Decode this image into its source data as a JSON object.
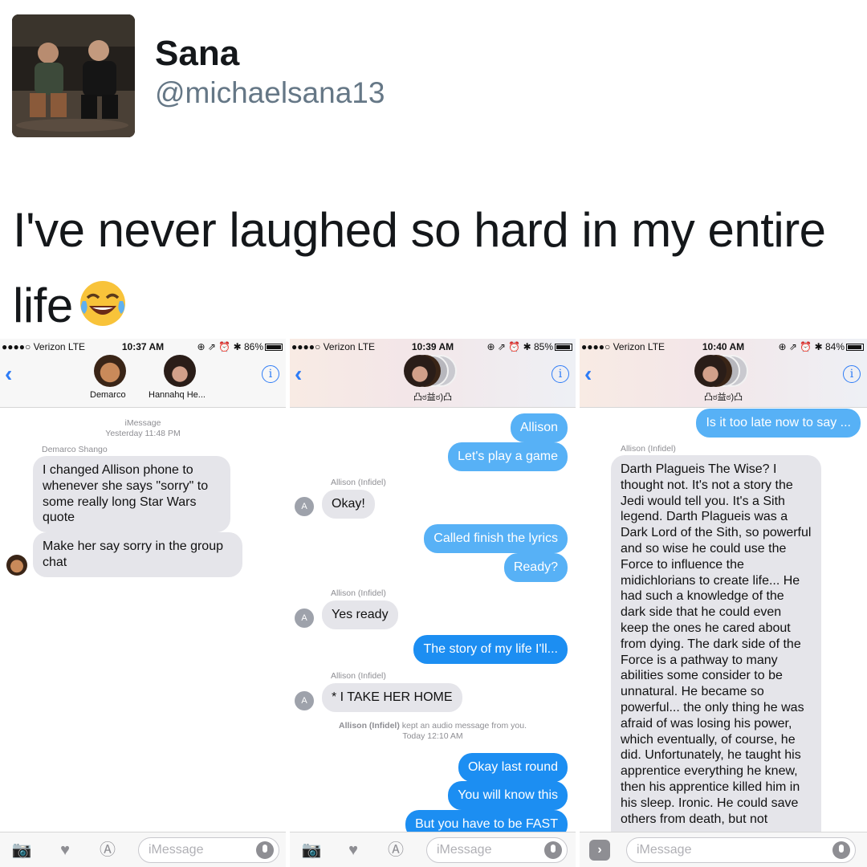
{
  "tweet": {
    "name": "Sana",
    "handle": "@michaelsana13",
    "text": "I've never laughed so hard in my entire life",
    "emoji_icon": "face-with-tears-of-joy-icon"
  },
  "screenshots": [
    {
      "status": {
        "carrier": "●●●●○ Verizon  LTE",
        "time": "10:37 AM",
        "icons": "⊕ ⇗ ⏰ ✱ 86%",
        "battery_level": 0.86
      },
      "contacts": [
        "Demarco",
        "Hannahq He..."
      ],
      "meta": {
        "service": "iMessage",
        "when": "Yesterday 11:48 PM",
        "sender": "Demarco Shango"
      },
      "messages": [
        "I changed Allison phone to whenever she says \"sorry\" to some really long Star Wars quote",
        "Make her say sorry in the group chat"
      ],
      "input_placeholder": "iMessage"
    },
    {
      "status": {
        "carrier": "●●●●○ Verizon  LTE",
        "time": "10:39 AM",
        "icons": "⊕ ⇗ ⏰ ✱ 85%",
        "battery_level": 0.85
      },
      "group_name": "凸ಠ益ಠ)凸",
      "sender_label": "Allison (Infidel)",
      "avatar_initial": "A",
      "messages": [
        {
          "dir": "out",
          "text": "Allison"
        },
        {
          "dir": "out",
          "text": "Let's play a game"
        },
        {
          "dir": "in",
          "text": "Okay!"
        },
        {
          "dir": "out",
          "text": "Called finish the lyrics"
        },
        {
          "dir": "out",
          "text": "Ready?"
        },
        {
          "dir": "in",
          "text": "Yes ready"
        },
        {
          "dir": "out",
          "text": "The story of my life I'll..."
        },
        {
          "dir": "in",
          "text": "* I TAKE HER HOME"
        },
        {
          "dir": "out",
          "text": "Okay last round"
        },
        {
          "dir": "out",
          "text": "You will know this"
        },
        {
          "dir": "out",
          "text": "But you have to be FAST"
        }
      ],
      "audio_note": {
        "who": "Allison (Infidel)",
        "what": " kept an audio message from you.",
        "when": "Today 12:10 AM"
      },
      "input_placeholder": "iMessage"
    },
    {
      "status": {
        "carrier": "●●●●○ Verizon  LTE",
        "time": "10:40 AM",
        "icons": "⊕ ⇗ ⏰ ✱ 84%",
        "battery_level": 0.84
      },
      "group_name": "凸ಠ益ಠ)凸",
      "sender_label": "Allison (Infidel)",
      "messages": [
        {
          "dir": "out",
          "text": "Is it too late now to say ..."
        },
        {
          "dir": "in",
          "text": "Darth Plagueis The Wise? I thought not. It's not a story the Jedi would tell you. It's a Sith legend. Darth Plagueis was a Dark Lord of the Sith, so powerful and so wise he could use the Force to influence the midichlorians to create life... He had such a knowledge of the dark side that he could even keep the ones he cared about from dying. The dark side of the Force is a pathway to many abilities some consider to be unnatural. He became so powerful... the only thing he was afraid of was losing his power, which eventually, of course, he did. Unfortunately, he taught his apprentice everything he knew, then his apprentice killed him in his sleep. Ironic. He could save others from death, but not"
        }
      ],
      "input_placeholder": "iMessage"
    }
  ]
}
